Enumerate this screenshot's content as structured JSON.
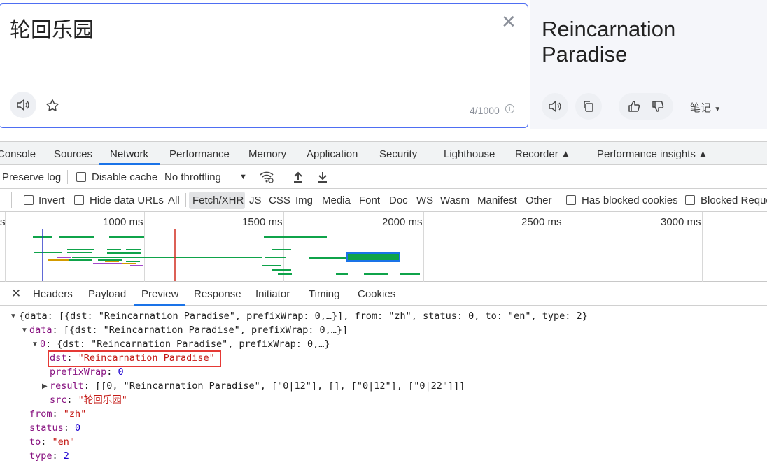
{
  "translator": {
    "source_text": "轮回乐园",
    "char_count": "4/1000",
    "target_text": "Reincarnation Paradise",
    "notes_label": "笔记"
  },
  "devtools": {
    "tabs": [
      "Console",
      "Sources",
      "Network",
      "Performance",
      "Memory",
      "Application",
      "Security",
      "Lighthouse",
      "Recorder",
      "Performance insights"
    ],
    "active_tab": "Network",
    "toolbar": {
      "preserve_log": "Preserve log",
      "disable_cache": "Disable cache",
      "throttling": "No throttling"
    },
    "filter": {
      "invert": "Invert",
      "hide_data_urls": "Hide data URLs",
      "types": [
        "All",
        "Fetch/XHR",
        "JS",
        "CSS",
        "Img",
        "Media",
        "Font",
        "Doc",
        "WS",
        "Wasm",
        "Manifest",
        "Other"
      ],
      "selected_type": "Fetch/XHR",
      "has_blocked_cookies": "Has blocked cookies",
      "blocked_requests": "Blocked Reque"
    },
    "timeline": {
      "ticks": [
        "1000 ms",
        "1500 ms",
        "2000 ms",
        "2500 ms",
        "3000 ms"
      ]
    },
    "detail_tabs": [
      "Headers",
      "Payload",
      "Preview",
      "Response",
      "Initiator",
      "Timing",
      "Cookies"
    ],
    "active_detail_tab": "Preview",
    "preview": {
      "line1_summary": "{data: [{dst: \"Reincarnation Paradise\", prefixWrap: 0,…}], from: \"zh\", status: 0, to: \"en\", type: 2}",
      "line2_key": "data",
      "line2_val": "[{dst: \"Reincarnation Paradise\", prefixWrap: 0,…}]",
      "line3_key": "0",
      "line3_val": "{dst: \"Reincarnation Paradise\", prefixWrap: 0,…}",
      "dst_key": "dst",
      "dst_val": "\"Reincarnation Paradise\"",
      "prefixwrap_key": "prefixWrap",
      "prefixwrap_val": "0",
      "result_key": "result",
      "result_val": "[[0, \"Reincarnation Paradise\", [\"0|12\"], [], [\"0|12\"], [\"0|22\"]]]",
      "src_key": "src",
      "src_val": "\"轮回乐园\"",
      "from_key": "from",
      "from_val": "\"zh\"",
      "status_key": "status",
      "status_val": "0",
      "to_key": "to",
      "to_val": "\"en\"",
      "type_key": "type",
      "type_val": "2"
    }
  }
}
